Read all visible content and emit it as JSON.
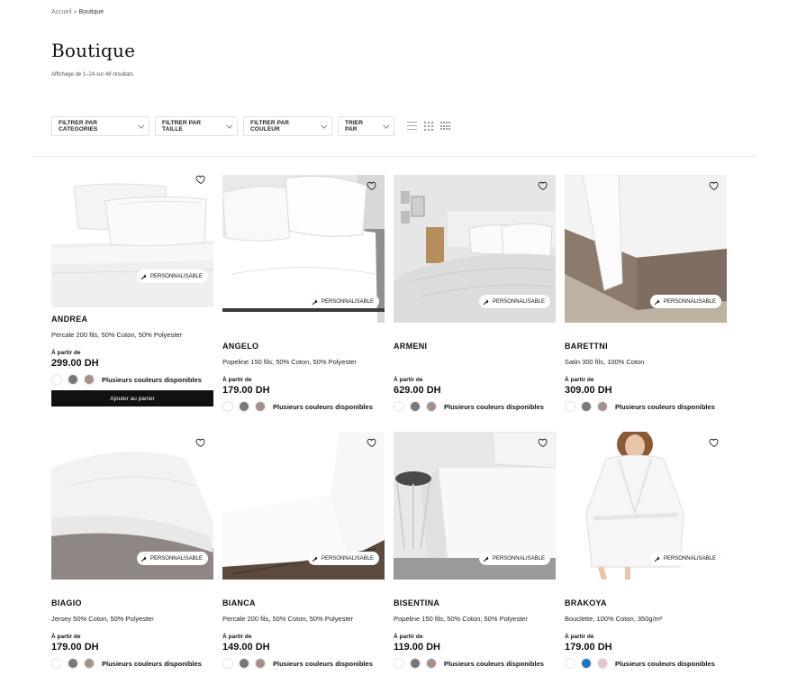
{
  "breadcrumb": {
    "home": "Accueil",
    "separator": "»",
    "current": "Boutique"
  },
  "page": {
    "title": "Boutique",
    "result_count": "Affichage de 1–24 sur 48 résultats"
  },
  "filters": {
    "categories": "FILTRER PAR CATEGORIES",
    "size": "FILTRER PAR TAILLE",
    "color": "FILTRER PAR COULEUR",
    "sort": "TRIER PAR"
  },
  "labels": {
    "from": "À partir de",
    "multiple_colors": "Plusieurs couleurs disponibles",
    "customizable": "PERSONNALISABLE",
    "add_to_cart": "Ajouter au panier"
  },
  "products": [
    {
      "name": "ANDREA",
      "desc": "Percale 200 fils, 50% Coton, 50% Polyester",
      "price": "299.00 DH",
      "swatches": [
        "#ffffff",
        "#7a767c",
        "#a3928a"
      ],
      "hovered": true
    },
    {
      "name": "ANGELO",
      "desc": "Popeline 150 fils, 50% Coton, 50% Polyester",
      "price": "179.00 DH",
      "swatches": [
        "#ffffff",
        "#7a767c",
        "#a3928a"
      ]
    },
    {
      "name": "ARMENI",
      "desc": "",
      "price": "629.00 DH",
      "swatches": [
        "#ffffff",
        "#7a767c",
        "#a3928a"
      ]
    },
    {
      "name": "BARETTNI",
      "desc": "Satin 300 fils, 100% Coton",
      "price": "309.00 DH",
      "swatches": [
        "#ffffff",
        "#7a767c",
        "#a3928a"
      ]
    },
    {
      "name": "BIAGIO",
      "desc": "Jersey 50% Coton, 50% Polyester",
      "price": "179.00 DH",
      "swatches": [
        "#ffffff",
        "#7a767c",
        "#a3928a"
      ]
    },
    {
      "name": "BIANCA",
      "desc": "Percale 200 fils, 50% Coton, 50% Polyester",
      "price": "149.00 DH",
      "swatches": [
        "#ffffff",
        "#7a767c",
        "#a3928a"
      ]
    },
    {
      "name": "BISENTINA",
      "desc": "Popeline 150 fils, 50% Coton, 50% Polyester",
      "price": "119.00 DH",
      "swatches": [
        "#ffffff",
        "#7a767c",
        "#a3928a"
      ]
    },
    {
      "name": "BRAKOYA",
      "desc": "Bouclette, 100% Coton, 350g/m²",
      "price": "179.00 DH",
      "swatches": [
        "#ffffff",
        "#1e73c4",
        "#e8c5d0"
      ]
    }
  ]
}
